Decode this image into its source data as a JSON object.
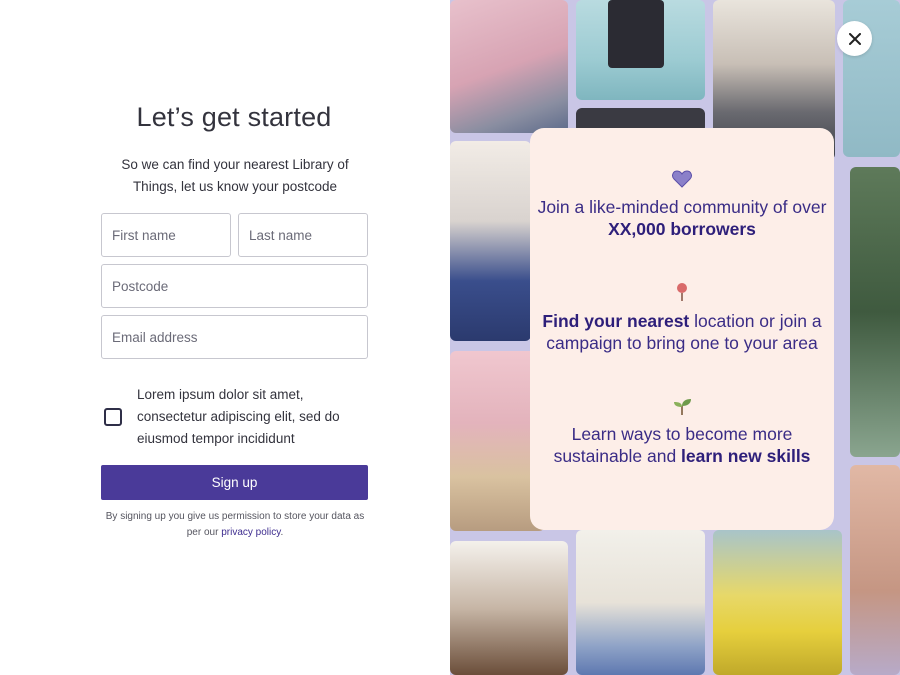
{
  "form": {
    "title": "Let’s get started",
    "subtitle": "So we can find your nearest Library of Things, let us know your postcode",
    "first_name_placeholder": "First name",
    "last_name_placeholder": "Last name",
    "postcode_placeholder": "Postcode",
    "email_placeholder": "Email address",
    "consent_text": "Lorem ipsum dolor sit amet, consectetur adipiscing elit, sed do eiusmod tempor incididunt",
    "consent_checked": false,
    "signup_label": "Sign up",
    "disclaimer_prefix": "By signing up you give us permission to store your data as per our",
    "privacy_link": "privacy policy",
    "disclaimer_suffix": "."
  },
  "features": [
    {
      "icon": "heart-icon",
      "pre": "Join a like-minded community of over ",
      "bold": "XX,000 borrowers",
      "post": ""
    },
    {
      "icon": "map-pin-icon",
      "pre": "",
      "bold": "Find your nearest",
      "post": " location or join a campaign to bring one to your area"
    },
    {
      "icon": "sprout-icon",
      "pre": "Learn ways to become more sustainable and ",
      "bold": "learn new skills",
      "post": ""
    }
  ],
  "colors": {
    "accent": "#4a3a99",
    "card_bg": "#fdeee8",
    "panel_bg": "#c9c6e6",
    "feature_text": "#3a2c86"
  }
}
